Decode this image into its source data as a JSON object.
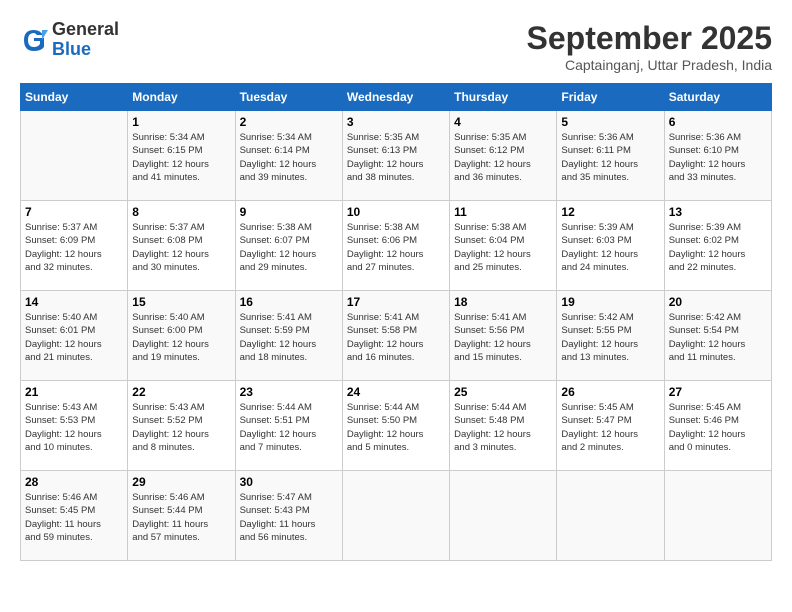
{
  "header": {
    "logo_general": "General",
    "logo_blue": "Blue",
    "month_title": "September 2025",
    "location": "Captainganj, Uttar Pradesh, India"
  },
  "days_of_week": [
    "Sunday",
    "Monday",
    "Tuesday",
    "Wednesday",
    "Thursday",
    "Friday",
    "Saturday"
  ],
  "weeks": [
    [
      {
        "day": "",
        "info": ""
      },
      {
        "day": "1",
        "info": "Sunrise: 5:34 AM\nSunset: 6:15 PM\nDaylight: 12 hours\nand 41 minutes."
      },
      {
        "day": "2",
        "info": "Sunrise: 5:34 AM\nSunset: 6:14 PM\nDaylight: 12 hours\nand 39 minutes."
      },
      {
        "day": "3",
        "info": "Sunrise: 5:35 AM\nSunset: 6:13 PM\nDaylight: 12 hours\nand 38 minutes."
      },
      {
        "day": "4",
        "info": "Sunrise: 5:35 AM\nSunset: 6:12 PM\nDaylight: 12 hours\nand 36 minutes."
      },
      {
        "day": "5",
        "info": "Sunrise: 5:36 AM\nSunset: 6:11 PM\nDaylight: 12 hours\nand 35 minutes."
      },
      {
        "day": "6",
        "info": "Sunrise: 5:36 AM\nSunset: 6:10 PM\nDaylight: 12 hours\nand 33 minutes."
      }
    ],
    [
      {
        "day": "7",
        "info": "Sunrise: 5:37 AM\nSunset: 6:09 PM\nDaylight: 12 hours\nand 32 minutes."
      },
      {
        "day": "8",
        "info": "Sunrise: 5:37 AM\nSunset: 6:08 PM\nDaylight: 12 hours\nand 30 minutes."
      },
      {
        "day": "9",
        "info": "Sunrise: 5:38 AM\nSunset: 6:07 PM\nDaylight: 12 hours\nand 29 minutes."
      },
      {
        "day": "10",
        "info": "Sunrise: 5:38 AM\nSunset: 6:06 PM\nDaylight: 12 hours\nand 27 minutes."
      },
      {
        "day": "11",
        "info": "Sunrise: 5:38 AM\nSunset: 6:04 PM\nDaylight: 12 hours\nand 25 minutes."
      },
      {
        "day": "12",
        "info": "Sunrise: 5:39 AM\nSunset: 6:03 PM\nDaylight: 12 hours\nand 24 minutes."
      },
      {
        "day": "13",
        "info": "Sunrise: 5:39 AM\nSunset: 6:02 PM\nDaylight: 12 hours\nand 22 minutes."
      }
    ],
    [
      {
        "day": "14",
        "info": "Sunrise: 5:40 AM\nSunset: 6:01 PM\nDaylight: 12 hours\nand 21 minutes."
      },
      {
        "day": "15",
        "info": "Sunrise: 5:40 AM\nSunset: 6:00 PM\nDaylight: 12 hours\nand 19 minutes."
      },
      {
        "day": "16",
        "info": "Sunrise: 5:41 AM\nSunset: 5:59 PM\nDaylight: 12 hours\nand 18 minutes."
      },
      {
        "day": "17",
        "info": "Sunrise: 5:41 AM\nSunset: 5:58 PM\nDaylight: 12 hours\nand 16 minutes."
      },
      {
        "day": "18",
        "info": "Sunrise: 5:41 AM\nSunset: 5:56 PM\nDaylight: 12 hours\nand 15 minutes."
      },
      {
        "day": "19",
        "info": "Sunrise: 5:42 AM\nSunset: 5:55 PM\nDaylight: 12 hours\nand 13 minutes."
      },
      {
        "day": "20",
        "info": "Sunrise: 5:42 AM\nSunset: 5:54 PM\nDaylight: 12 hours\nand 11 minutes."
      }
    ],
    [
      {
        "day": "21",
        "info": "Sunrise: 5:43 AM\nSunset: 5:53 PM\nDaylight: 12 hours\nand 10 minutes."
      },
      {
        "day": "22",
        "info": "Sunrise: 5:43 AM\nSunset: 5:52 PM\nDaylight: 12 hours\nand 8 minutes."
      },
      {
        "day": "23",
        "info": "Sunrise: 5:44 AM\nSunset: 5:51 PM\nDaylight: 12 hours\nand 7 minutes."
      },
      {
        "day": "24",
        "info": "Sunrise: 5:44 AM\nSunset: 5:50 PM\nDaylight: 12 hours\nand 5 minutes."
      },
      {
        "day": "25",
        "info": "Sunrise: 5:44 AM\nSunset: 5:48 PM\nDaylight: 12 hours\nand 3 minutes."
      },
      {
        "day": "26",
        "info": "Sunrise: 5:45 AM\nSunset: 5:47 PM\nDaylight: 12 hours\nand 2 minutes."
      },
      {
        "day": "27",
        "info": "Sunrise: 5:45 AM\nSunset: 5:46 PM\nDaylight: 12 hours\nand 0 minutes."
      }
    ],
    [
      {
        "day": "28",
        "info": "Sunrise: 5:46 AM\nSunset: 5:45 PM\nDaylight: 11 hours\nand 59 minutes."
      },
      {
        "day": "29",
        "info": "Sunrise: 5:46 AM\nSunset: 5:44 PM\nDaylight: 11 hours\nand 57 minutes."
      },
      {
        "day": "30",
        "info": "Sunrise: 5:47 AM\nSunset: 5:43 PM\nDaylight: 11 hours\nand 56 minutes."
      },
      {
        "day": "",
        "info": ""
      },
      {
        "day": "",
        "info": ""
      },
      {
        "day": "",
        "info": ""
      },
      {
        "day": "",
        "info": ""
      }
    ]
  ]
}
